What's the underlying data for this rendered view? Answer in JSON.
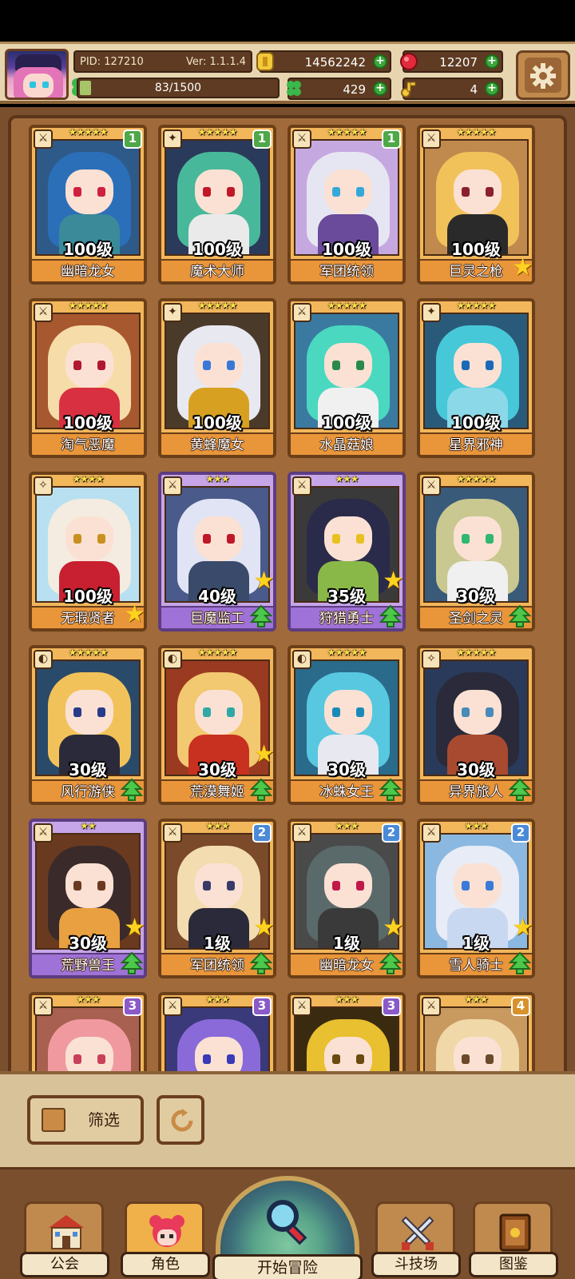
{
  "header": {
    "pid": "PID: 127210",
    "version": "Ver: 1.1.1.4",
    "gold": "14562242",
    "gems": "12207",
    "exp": "83/1500",
    "exp_progress": 0.055,
    "clover": "429",
    "keys": "4"
  },
  "cards": [
    {
      "name": "幽暗龙女",
      "level": "100级",
      "stars": "★★★★★",
      "rank": "1",
      "frame": "gold",
      "cls": "⚔",
      "hair": "#2b6fb8",
      "eye": "#d02040",
      "body": "#3a8a9a",
      "bg": "#2e5a8a",
      "star_badge": false,
      "up_badge": false
    },
    {
      "name": "魔术大师",
      "level": "100级",
      "stars": "★★★★★",
      "rank": "1",
      "frame": "gold",
      "cls": "✦",
      "hair": "#48b89a",
      "eye": "#c01828",
      "body": "#eaeaea",
      "bg": "#2a3a5a",
      "star_badge": false,
      "up_badge": false
    },
    {
      "name": "军团统领",
      "level": "100级",
      "stars": "★★★★★",
      "rank": "1",
      "frame": "gold",
      "cls": "⚔",
      "hair": "#e6e6f2",
      "eye": "#36a8d8",
      "body": "#6a4a9a",
      "bg": "#c6a8e0",
      "star_badge": false,
      "up_badge": false
    },
    {
      "name": "巨灵之枪",
      "level": "100级",
      "stars": "★★★★★",
      "rank": "",
      "frame": "gold",
      "cls": "⚔",
      "hair": "#f2c25a",
      "eye": "#8a2030",
      "body": "#2a2a2a",
      "bg": "#c08a4e",
      "star_badge": true,
      "up_badge": false
    },
    {
      "name": "淘气恶魔",
      "level": "100级",
      "stars": "★★★★★",
      "rank": "",
      "frame": "gold",
      "cls": "⚔",
      "hair": "#f6dca8",
      "eye": "#b01830",
      "body": "#d83040",
      "bg": "#a8582e",
      "star_badge": false,
      "up_badge": false
    },
    {
      "name": "黄蜂魔女",
      "level": "100级",
      "stars": "★★★★★",
      "rank": "",
      "frame": "gold",
      "cls": "✦",
      "hair": "#e8e8f0",
      "eye": "#3a78d8",
      "body": "#d8a020",
      "bg": "#4a3a2a",
      "star_badge": false,
      "up_badge": false
    },
    {
      "name": "水晶菇娘",
      "level": "100级",
      "stars": "★★★★★",
      "rank": "",
      "frame": "gold",
      "cls": "⚔",
      "hair": "#4ad8c0",
      "eye": "#2a8a4a",
      "body": "#f0f0f0",
      "bg": "#3a7aa0",
      "star_badge": false,
      "up_badge": false
    },
    {
      "name": "星界邪神",
      "level": "100级",
      "stars": "★★★★★",
      "rank": "",
      "frame": "gold",
      "cls": "✦",
      "hair": "#46c8d8",
      "eye": "#1a6ab8",
      "body": "#8ad8e8",
      "bg": "#2a5a7a",
      "star_badge": false,
      "up_badge": false
    },
    {
      "name": "无瑕贤者",
      "level": "100级",
      "stars": "★★★★",
      "rank": "",
      "frame": "gold",
      "cls": "✧",
      "hair": "#f4ece0",
      "eye": "#c89020",
      "body": "#c82030",
      "bg": "#b8e0f0",
      "star_badge": true,
      "up_badge": false
    },
    {
      "name": "巨魔监工",
      "level": "40级",
      "stars": "★★★",
      "rank": "",
      "frame": "purple",
      "cls": "⚔",
      "hair": "#e0e4f4",
      "eye": "#c01828",
      "body": "#3a4a6a",
      "bg": "#4a5a8a",
      "star_badge": true,
      "up_badge": true
    },
    {
      "name": "狩猎勇士",
      "level": "35级",
      "stars": "★★★",
      "rank": "",
      "frame": "purple",
      "cls": "⚔",
      "hair": "#2a2a4a",
      "eye": "#e8c020",
      "body": "#8ab848",
      "bg": "#3a3a3a",
      "star_badge": true,
      "up_badge": true
    },
    {
      "name": "圣剑之灵",
      "level": "30级",
      "stars": "★★★★★",
      "rank": "",
      "frame": "gold",
      "cls": "⚔",
      "hair": "#c8c890",
      "eye": "#30b870",
      "body": "#f0f0f0",
      "bg": "#3a5a7a",
      "star_badge": false,
      "up_badge": true
    },
    {
      "name": "风行游侠",
      "level": "30级",
      "stars": "★★★★★",
      "rank": "",
      "frame": "gold",
      "cls": "◐",
      "hair": "#f2c25a",
      "eye": "#2a3a8a",
      "body": "#2a2a3a",
      "bg": "#2a4a6a",
      "star_badge": false,
      "up_badge": true
    },
    {
      "name": "荒漠舞姬",
      "level": "30级",
      "stars": "★★★★★",
      "rank": "",
      "frame": "gold",
      "cls": "◐",
      "hair": "#f2c870",
      "eye": "#30a8a8",
      "body": "#c83020",
      "bg": "#9a3a20",
      "star_badge": true,
      "up_badge": true
    },
    {
      "name": "冰蛛女王",
      "level": "30级",
      "stars": "★★★★★",
      "rank": "",
      "frame": "gold",
      "cls": "◐",
      "hair": "#58c8e0",
      "eye": "#1a8ab8",
      "body": "#e8e8f0",
      "bg": "#2a6a8a",
      "star_badge": false,
      "up_badge": true
    },
    {
      "name": "异界旅人",
      "level": "30级",
      "stars": "★★★★★",
      "rank": "",
      "frame": "gold",
      "cls": "✧",
      "hair": "#2a2a3a",
      "eye": "#4a8ab8",
      "body": "#a84a30",
      "bg": "#2a3a5a",
      "star_badge": false,
      "up_badge": true
    },
    {
      "name": "荒野兽王",
      "level": "30级",
      "stars": "★★",
      "rank": "",
      "frame": "purple",
      "cls": "⚔",
      "hair": "#3a2a2a",
      "eye": "#6a3a20",
      "body": "#e8a040",
      "bg": "#6a3a20",
      "star_badge": true,
      "up_badge": true
    },
    {
      "name": "军团统领",
      "level": "1级",
      "stars": "★★★",
      "rank": "2",
      "frame": "gold",
      "cls": "⚔",
      "hair": "#f2dcb0",
      "eye": "#3a3a6a",
      "body": "#2a2a3a",
      "bg": "#7a4a2a",
      "star_badge": true,
      "up_badge": true
    },
    {
      "name": "幽暗龙女",
      "level": "1级",
      "stars": "★★★",
      "rank": "2",
      "frame": "gold",
      "cls": "⚔",
      "hair": "#5a6a6a",
      "eye": "#c01848",
      "body": "#3a3a3a",
      "bg": "#4a4a4a",
      "star_badge": true,
      "up_badge": true
    },
    {
      "name": "雪人骑士",
      "level": "1级",
      "stars": "★★★",
      "rank": "2",
      "frame": "gold",
      "cls": "⚔",
      "hair": "#e8ecf6",
      "eye": "#3a7ad8",
      "body": "#c8d8f0",
      "bg": "#8ab8e0",
      "star_badge": true,
      "up_badge": true
    },
    {
      "name": "",
      "level": "",
      "stars": "★★★",
      "rank": "3",
      "frame": "gold",
      "cls": "⚔",
      "hair": "#f09aa0",
      "eye": "#c8405a",
      "body": "#f0b0b0",
      "bg": "#a86050",
      "star_badge": false,
      "up_badge": false
    },
    {
      "name": "",
      "level": "",
      "stars": "★★★",
      "rank": "3",
      "frame": "gold",
      "cls": "⚔",
      "hair": "#8a6ad8",
      "eye": "#3a3ab8",
      "body": "#6a5ab8",
      "bg": "#3a3a7a",
      "star_badge": false,
      "up_badge": false
    },
    {
      "name": "",
      "level": "",
      "stars": "★★★",
      "rank": "3",
      "frame": "gold",
      "cls": "⚔",
      "hair": "#e8c030",
      "eye": "#6a4a10",
      "body": "#c8a020",
      "bg": "#3a2a10",
      "star_badge": false,
      "up_badge": false
    },
    {
      "name": "",
      "level": "",
      "stars": "★★★",
      "rank": "4",
      "frame": "gold",
      "cls": "⚔",
      "hair": "#f0d8a8",
      "eye": "#6a4a2a",
      "body": "#e8c090",
      "bg": "#c89a60",
      "star_badge": false,
      "up_badge": false
    }
  ],
  "controls": {
    "filter_label": "筛选"
  },
  "nav": {
    "guild": "公会",
    "characters": "角色",
    "adventure": "开始冒险",
    "arena": "斗技场",
    "codex": "图鉴"
  },
  "colors": {
    "rank_1": "#4fa848",
    "rank_2": "#4a8ad8",
    "rank_3": "#8a5ac8",
    "rank_4": "#d8922a"
  }
}
